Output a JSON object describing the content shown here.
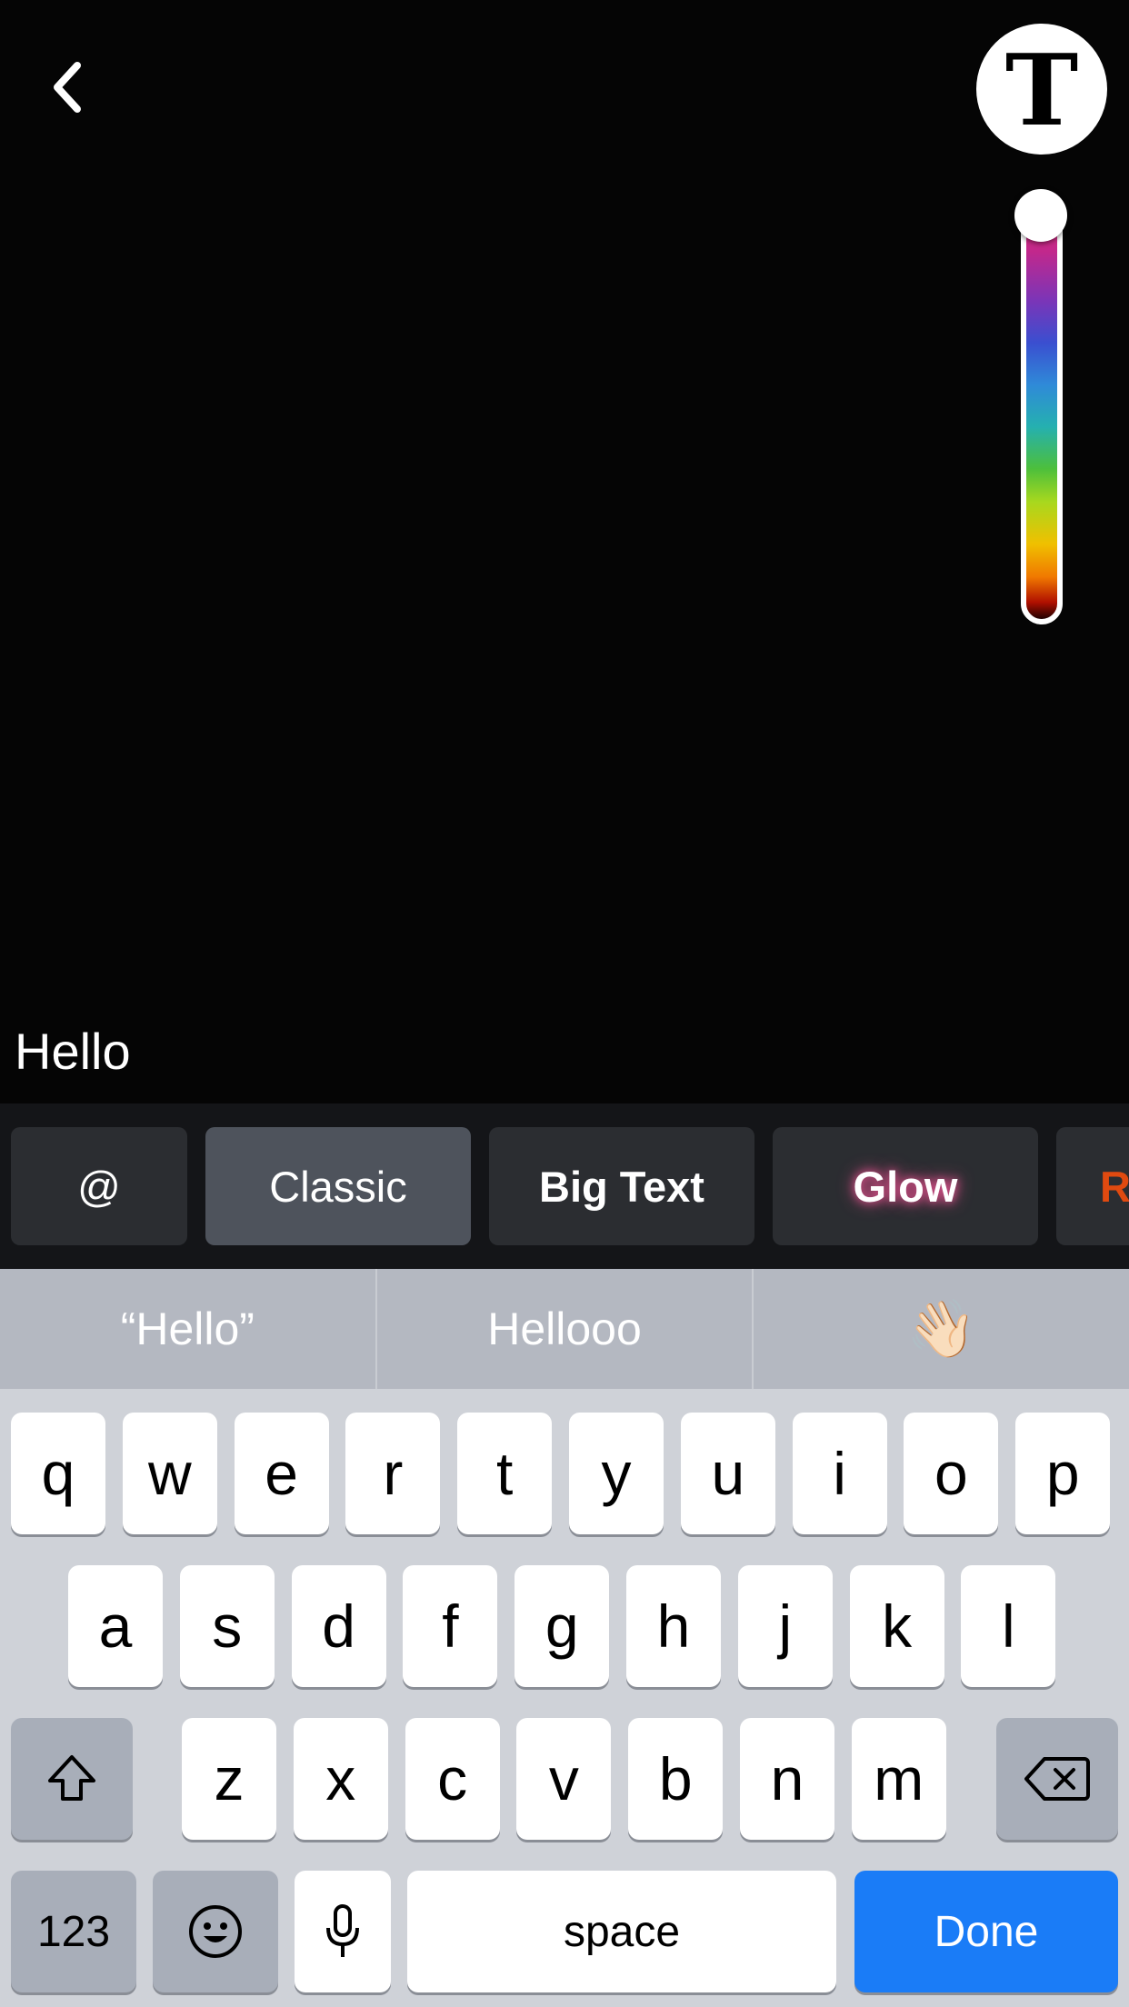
{
  "editor": {
    "back_icon": "chevron-left-icon",
    "text_style_button_label": "T",
    "color_slider": {
      "colors": [
        "#e8306f",
        "#7a35b8",
        "#3a4fd0",
        "#25b0b0",
        "#4cbf3c",
        "#f0c000",
        "#f07800",
        "#200000"
      ]
    },
    "caption_text": "Hello"
  },
  "style_bar": {
    "chips": [
      {
        "label": "@"
      },
      {
        "label": "Classic"
      },
      {
        "label": "Big Text"
      },
      {
        "label": "Glow"
      },
      {
        "label": "R"
      }
    ]
  },
  "keyboard": {
    "suggestions": [
      "“Hello”",
      "Hellooo",
      "👋🏻"
    ],
    "row1": [
      "q",
      "w",
      "e",
      "r",
      "t",
      "y",
      "u",
      "i",
      "o",
      "p"
    ],
    "row2": [
      "a",
      "s",
      "d",
      "f",
      "g",
      "h",
      "j",
      "k",
      "l"
    ],
    "row3": [
      "z",
      "x",
      "c",
      "v",
      "b",
      "n",
      "m"
    ],
    "numbers_label": "123",
    "space_label": "space",
    "done_label": "Done",
    "done_color": "#1a7cf7",
    "icons": {
      "shift": "shift-icon",
      "delete": "backspace-icon",
      "emoji": "emoji-icon",
      "mic": "microphone-icon"
    }
  }
}
